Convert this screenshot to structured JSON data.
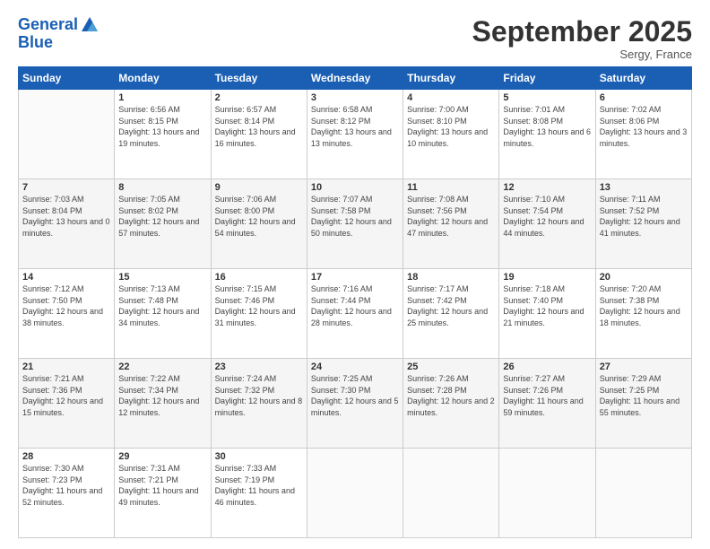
{
  "header": {
    "logo_line1": "General",
    "logo_line2": "Blue",
    "month": "September 2025",
    "location": "Sergy, France"
  },
  "days_of_week": [
    "Sunday",
    "Monday",
    "Tuesday",
    "Wednesday",
    "Thursday",
    "Friday",
    "Saturday"
  ],
  "weeks": [
    [
      {
        "day": "",
        "sunrise": "",
        "sunset": "",
        "daylight": ""
      },
      {
        "day": "1",
        "sunrise": "Sunrise: 6:56 AM",
        "sunset": "Sunset: 8:15 PM",
        "daylight": "Daylight: 13 hours and 19 minutes."
      },
      {
        "day": "2",
        "sunrise": "Sunrise: 6:57 AM",
        "sunset": "Sunset: 8:14 PM",
        "daylight": "Daylight: 13 hours and 16 minutes."
      },
      {
        "day": "3",
        "sunrise": "Sunrise: 6:58 AM",
        "sunset": "Sunset: 8:12 PM",
        "daylight": "Daylight: 13 hours and 13 minutes."
      },
      {
        "day": "4",
        "sunrise": "Sunrise: 7:00 AM",
        "sunset": "Sunset: 8:10 PM",
        "daylight": "Daylight: 13 hours and 10 minutes."
      },
      {
        "day": "5",
        "sunrise": "Sunrise: 7:01 AM",
        "sunset": "Sunset: 8:08 PM",
        "daylight": "Daylight: 13 hours and 6 minutes."
      },
      {
        "day": "6",
        "sunrise": "Sunrise: 7:02 AM",
        "sunset": "Sunset: 8:06 PM",
        "daylight": "Daylight: 13 hours and 3 minutes."
      }
    ],
    [
      {
        "day": "7",
        "sunrise": "Sunrise: 7:03 AM",
        "sunset": "Sunset: 8:04 PM",
        "daylight": "Daylight: 13 hours and 0 minutes."
      },
      {
        "day": "8",
        "sunrise": "Sunrise: 7:05 AM",
        "sunset": "Sunset: 8:02 PM",
        "daylight": "Daylight: 12 hours and 57 minutes."
      },
      {
        "day": "9",
        "sunrise": "Sunrise: 7:06 AM",
        "sunset": "Sunset: 8:00 PM",
        "daylight": "Daylight: 12 hours and 54 minutes."
      },
      {
        "day": "10",
        "sunrise": "Sunrise: 7:07 AM",
        "sunset": "Sunset: 7:58 PM",
        "daylight": "Daylight: 12 hours and 50 minutes."
      },
      {
        "day": "11",
        "sunrise": "Sunrise: 7:08 AM",
        "sunset": "Sunset: 7:56 PM",
        "daylight": "Daylight: 12 hours and 47 minutes."
      },
      {
        "day": "12",
        "sunrise": "Sunrise: 7:10 AM",
        "sunset": "Sunset: 7:54 PM",
        "daylight": "Daylight: 12 hours and 44 minutes."
      },
      {
        "day": "13",
        "sunrise": "Sunrise: 7:11 AM",
        "sunset": "Sunset: 7:52 PM",
        "daylight": "Daylight: 12 hours and 41 minutes."
      }
    ],
    [
      {
        "day": "14",
        "sunrise": "Sunrise: 7:12 AM",
        "sunset": "Sunset: 7:50 PM",
        "daylight": "Daylight: 12 hours and 38 minutes."
      },
      {
        "day": "15",
        "sunrise": "Sunrise: 7:13 AM",
        "sunset": "Sunset: 7:48 PM",
        "daylight": "Daylight: 12 hours and 34 minutes."
      },
      {
        "day": "16",
        "sunrise": "Sunrise: 7:15 AM",
        "sunset": "Sunset: 7:46 PM",
        "daylight": "Daylight: 12 hours and 31 minutes."
      },
      {
        "day": "17",
        "sunrise": "Sunrise: 7:16 AM",
        "sunset": "Sunset: 7:44 PM",
        "daylight": "Daylight: 12 hours and 28 minutes."
      },
      {
        "day": "18",
        "sunrise": "Sunrise: 7:17 AM",
        "sunset": "Sunset: 7:42 PM",
        "daylight": "Daylight: 12 hours and 25 minutes."
      },
      {
        "day": "19",
        "sunrise": "Sunrise: 7:18 AM",
        "sunset": "Sunset: 7:40 PM",
        "daylight": "Daylight: 12 hours and 21 minutes."
      },
      {
        "day": "20",
        "sunrise": "Sunrise: 7:20 AM",
        "sunset": "Sunset: 7:38 PM",
        "daylight": "Daylight: 12 hours and 18 minutes."
      }
    ],
    [
      {
        "day": "21",
        "sunrise": "Sunrise: 7:21 AM",
        "sunset": "Sunset: 7:36 PM",
        "daylight": "Daylight: 12 hours and 15 minutes."
      },
      {
        "day": "22",
        "sunrise": "Sunrise: 7:22 AM",
        "sunset": "Sunset: 7:34 PM",
        "daylight": "Daylight: 12 hours and 12 minutes."
      },
      {
        "day": "23",
        "sunrise": "Sunrise: 7:24 AM",
        "sunset": "Sunset: 7:32 PM",
        "daylight": "Daylight: 12 hours and 8 minutes."
      },
      {
        "day": "24",
        "sunrise": "Sunrise: 7:25 AM",
        "sunset": "Sunset: 7:30 PM",
        "daylight": "Daylight: 12 hours and 5 minutes."
      },
      {
        "day": "25",
        "sunrise": "Sunrise: 7:26 AM",
        "sunset": "Sunset: 7:28 PM",
        "daylight": "Daylight: 12 hours and 2 minutes."
      },
      {
        "day": "26",
        "sunrise": "Sunrise: 7:27 AM",
        "sunset": "Sunset: 7:26 PM",
        "daylight": "Daylight: 11 hours and 59 minutes."
      },
      {
        "day": "27",
        "sunrise": "Sunrise: 7:29 AM",
        "sunset": "Sunset: 7:25 PM",
        "daylight": "Daylight: 11 hours and 55 minutes."
      }
    ],
    [
      {
        "day": "28",
        "sunrise": "Sunrise: 7:30 AM",
        "sunset": "Sunset: 7:23 PM",
        "daylight": "Daylight: 11 hours and 52 minutes."
      },
      {
        "day": "29",
        "sunrise": "Sunrise: 7:31 AM",
        "sunset": "Sunset: 7:21 PM",
        "daylight": "Daylight: 11 hours and 49 minutes."
      },
      {
        "day": "30",
        "sunrise": "Sunrise: 7:33 AM",
        "sunset": "Sunset: 7:19 PM",
        "daylight": "Daylight: 11 hours and 46 minutes."
      },
      {
        "day": "",
        "sunrise": "",
        "sunset": "",
        "daylight": ""
      },
      {
        "day": "",
        "sunrise": "",
        "sunset": "",
        "daylight": ""
      },
      {
        "day": "",
        "sunrise": "",
        "sunset": "",
        "daylight": ""
      },
      {
        "day": "",
        "sunrise": "",
        "sunset": "",
        "daylight": ""
      }
    ]
  ]
}
